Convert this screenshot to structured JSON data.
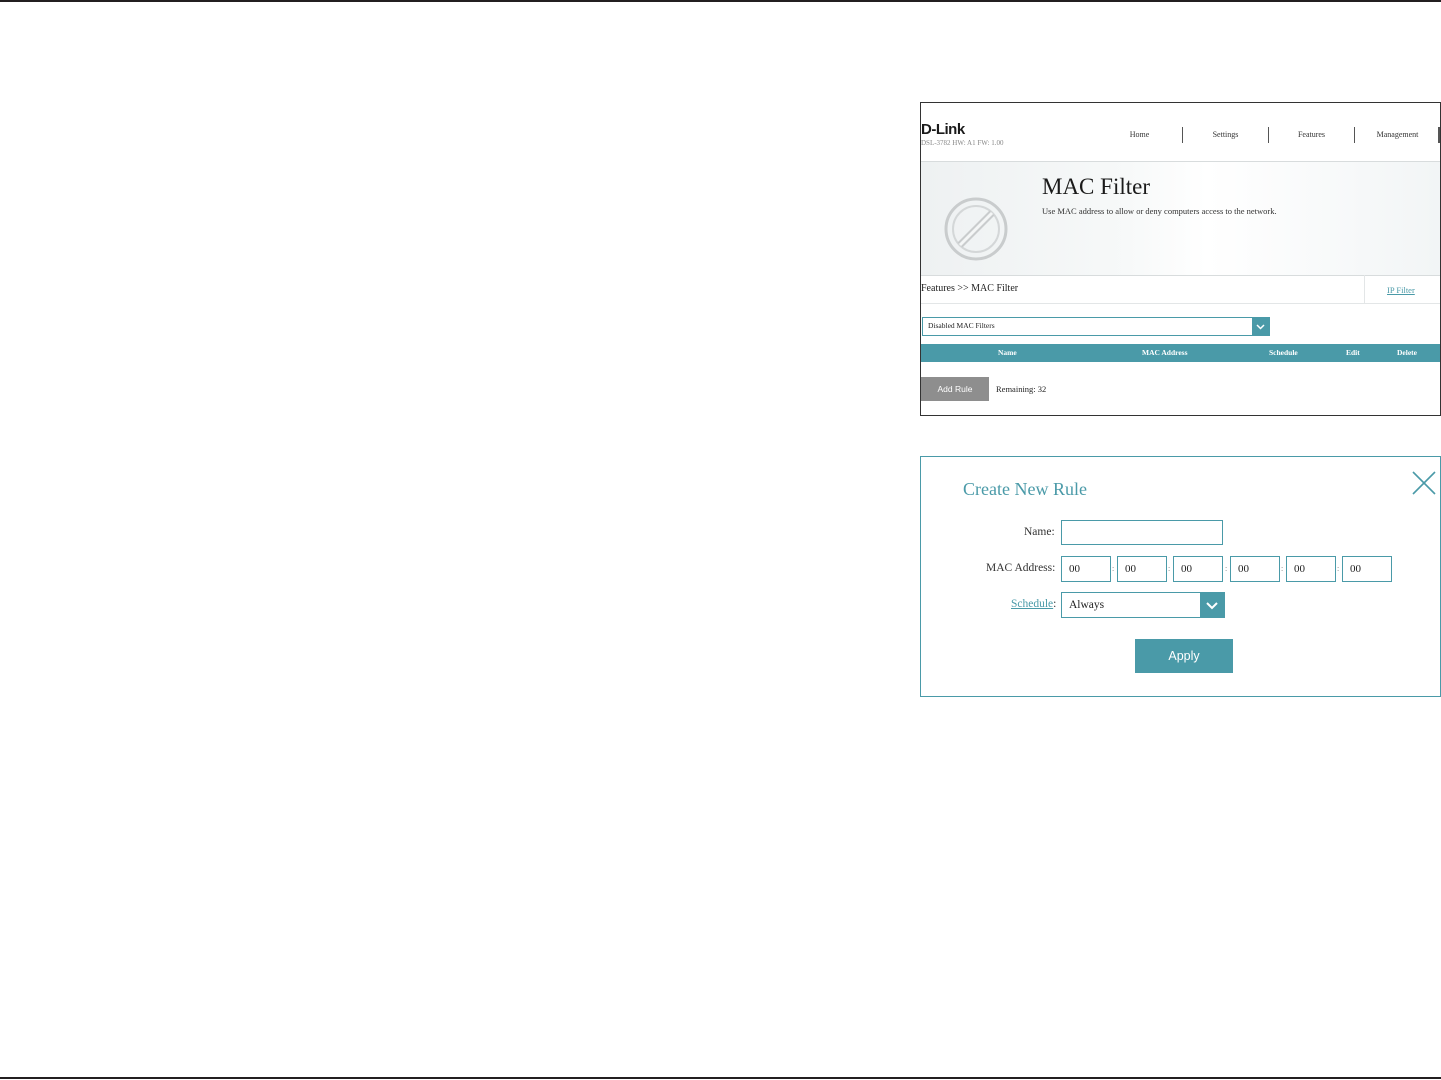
{
  "router": {
    "brand": "D-Link",
    "model_info": "DSL-3782  HW: A1  FW: 1.00",
    "nav": [
      "Home",
      "Settings",
      "Features",
      "Management"
    ],
    "page_title": "MAC Filter",
    "page_description": "Use MAC address to allow or deny computers access to the network.",
    "breadcrumb": "Features >> MAC Filter",
    "ip_filter_link": "IP Filter",
    "filter_mode": "Disabled MAC Filters",
    "table_headers": [
      "Name",
      "MAC Address",
      "Schedule",
      "Edit",
      "Delete"
    ],
    "add_rule_label": "Add Rule",
    "remaining_label": "Remaining: 32"
  },
  "dialog": {
    "title": "Create New Rule",
    "name_label": "Name:",
    "name_value": "",
    "mac_label": "MAC Address:",
    "mac_octets": [
      "00",
      "00",
      "00",
      "00",
      "00",
      "00"
    ],
    "mac_separator": ":",
    "schedule_label": "Schedule",
    "schedule_colon": ":",
    "schedule_value": "Always",
    "apply_label": "Apply"
  },
  "colors": {
    "accent": "#4a9aa8",
    "button_gray": "#8e8e8e"
  },
  "icons": [
    "block-icon",
    "chevron-down-icon",
    "close-icon"
  ]
}
